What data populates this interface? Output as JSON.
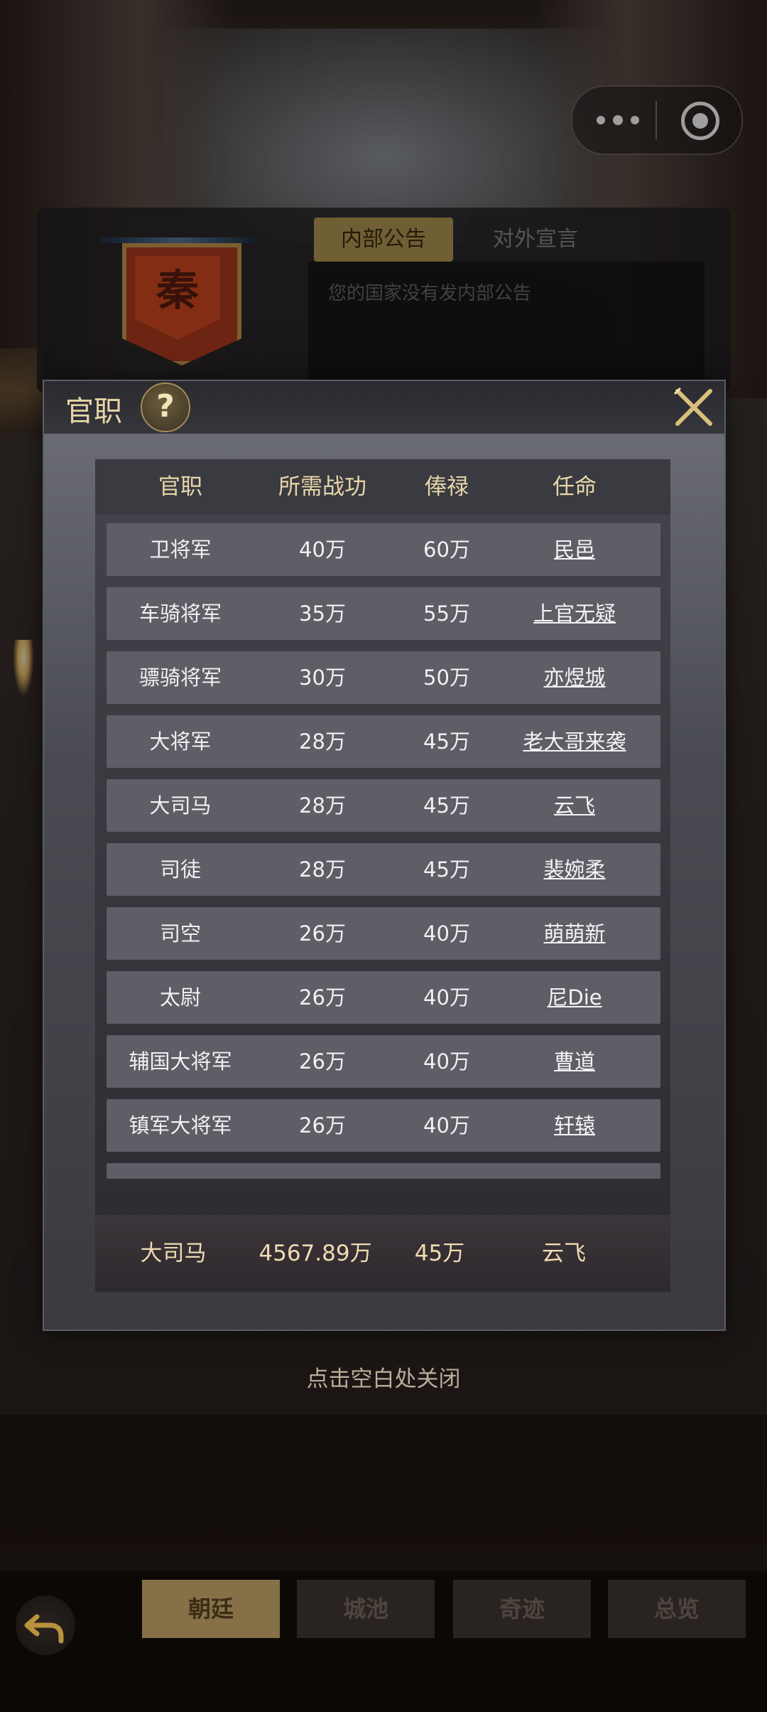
{
  "capsule": {
    "more_icon": "more-dots-icon",
    "close_icon": "target-close-icon"
  },
  "kingdom": {
    "banner_char": "秦",
    "tabs": [
      {
        "label": "内部公告"
      },
      {
        "label": "对外宣言"
      }
    ],
    "message": "您的国家没有发内部公告"
  },
  "dialog": {
    "title": "官职",
    "help_label": "?",
    "headers": [
      "官职",
      "所需战功",
      "俸禄",
      "任命"
    ],
    "rows": [
      {
        "title": "卫将军",
        "merit": "40万",
        "salary": "60万",
        "appointee": "民邑"
      },
      {
        "title": "车骑将军",
        "merit": "35万",
        "salary": "55万",
        "appointee": "上官无疑"
      },
      {
        "title": "骠骑将军",
        "merit": "30万",
        "salary": "50万",
        "appointee": "亦煜城"
      },
      {
        "title": "大将军",
        "merit": "28万",
        "salary": "45万",
        "appointee": "老大哥来袭"
      },
      {
        "title": "大司马",
        "merit": "28万",
        "salary": "45万",
        "appointee": "云飞"
      },
      {
        "title": "司徒",
        "merit": "28万",
        "salary": "45万",
        "appointee": "裴婉柔"
      },
      {
        "title": "司空",
        "merit": "26万",
        "salary": "40万",
        "appointee": "萌萌新"
      },
      {
        "title": "太尉",
        "merit": "26万",
        "salary": "40万",
        "appointee": "尼Die"
      },
      {
        "title": "辅国大将军",
        "merit": "26万",
        "salary": "40万",
        "appointee": "曹道"
      },
      {
        "title": "镇军大将军",
        "merit": "26万",
        "salary": "40万",
        "appointee": "轩辕"
      }
    ],
    "my_position": {
      "title": "大司马",
      "merit": "4567.89万",
      "salary": "45万",
      "appointee": "云飞"
    }
  },
  "close_hint": "点击空白处关闭",
  "bottom_nav": {
    "back_icon": "back-arrow-icon",
    "tabs": [
      {
        "label": "朝廷",
        "active": true
      },
      {
        "label": "城池",
        "active": false
      },
      {
        "label": "奇迹",
        "active": false
      },
      {
        "label": "总览",
        "active": false
      }
    ]
  }
}
